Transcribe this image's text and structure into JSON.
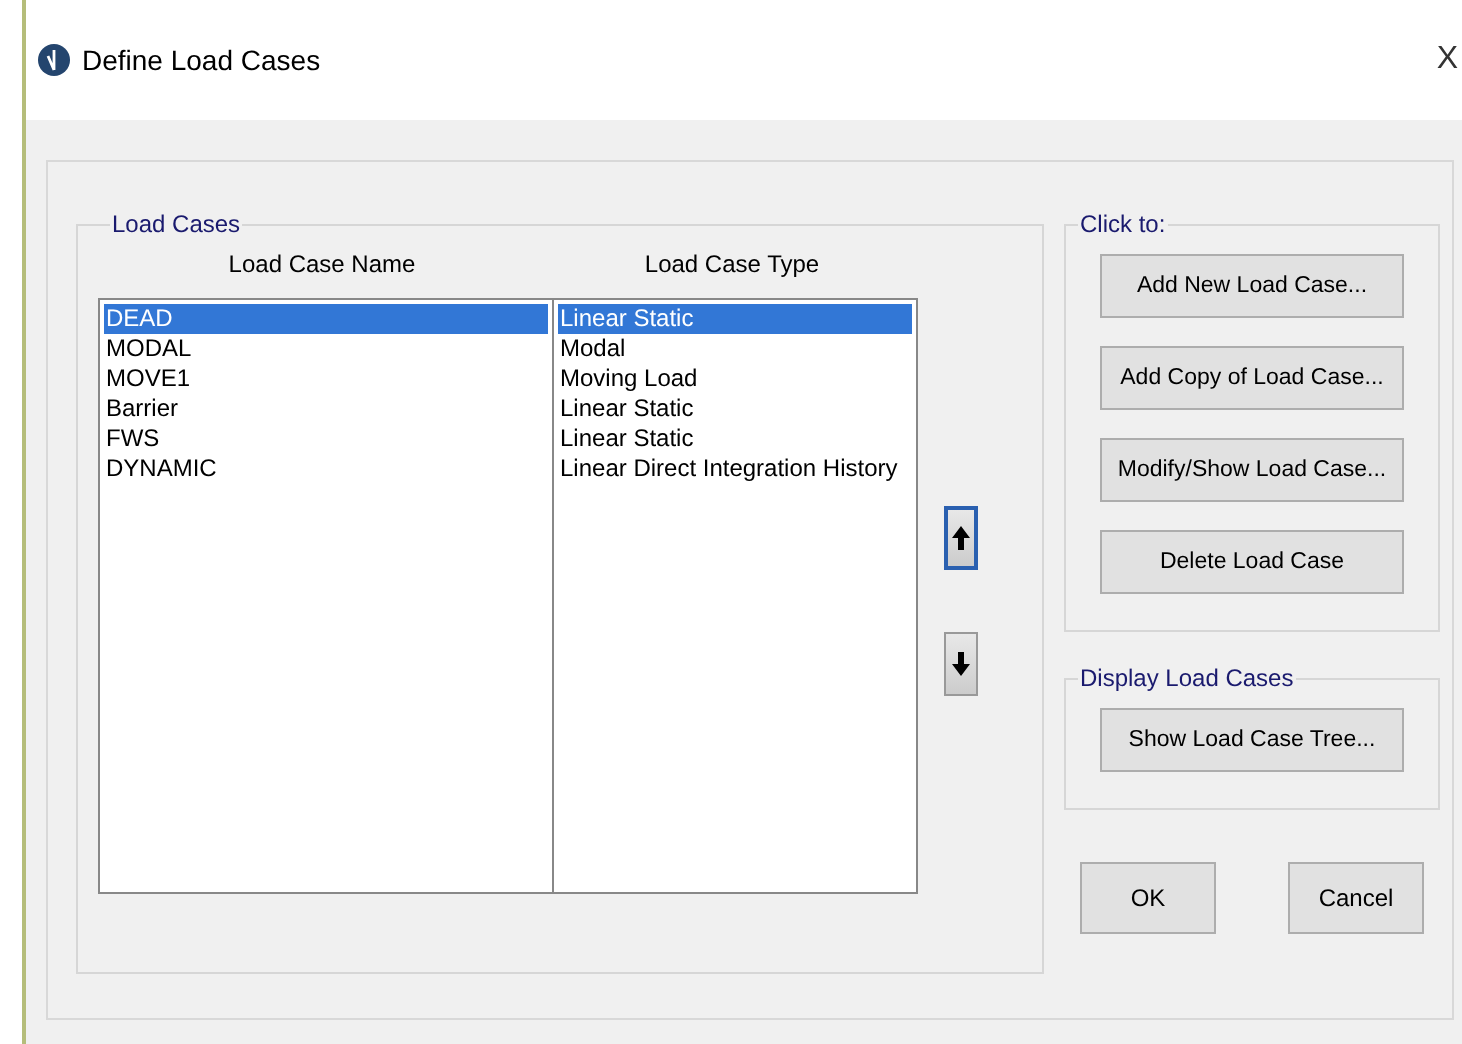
{
  "window": {
    "title": "Define Load Cases",
    "close": "X"
  },
  "load_cases": {
    "title": "Load Cases",
    "columns": [
      "Load Case Name",
      "Load Case Type"
    ],
    "rows": [
      {
        "name": "DEAD",
        "type": "Linear Static",
        "selected": true
      },
      {
        "name": "MODAL",
        "type": "Modal",
        "selected": false
      },
      {
        "name": "MOVE1",
        "type": "Moving Load",
        "selected": false
      },
      {
        "name": "Barrier",
        "type": "Linear Static",
        "selected": false
      },
      {
        "name": "FWS",
        "type": "Linear Static",
        "selected": false
      },
      {
        "name": "DYNAMIC",
        "type": "Linear Direct Integration History",
        "selected": false
      }
    ]
  },
  "click_to": {
    "title": "Click to:",
    "buttons": [
      "Add New Load Case...",
      "Add Copy of Load Case...",
      "Modify/Show Load Case...",
      "Delete Load Case"
    ]
  },
  "display": {
    "title": "Display Load Cases",
    "buttons": [
      "Show Load Case Tree..."
    ]
  },
  "footer_buttons": [
    "OK",
    "Cancel"
  ]
}
